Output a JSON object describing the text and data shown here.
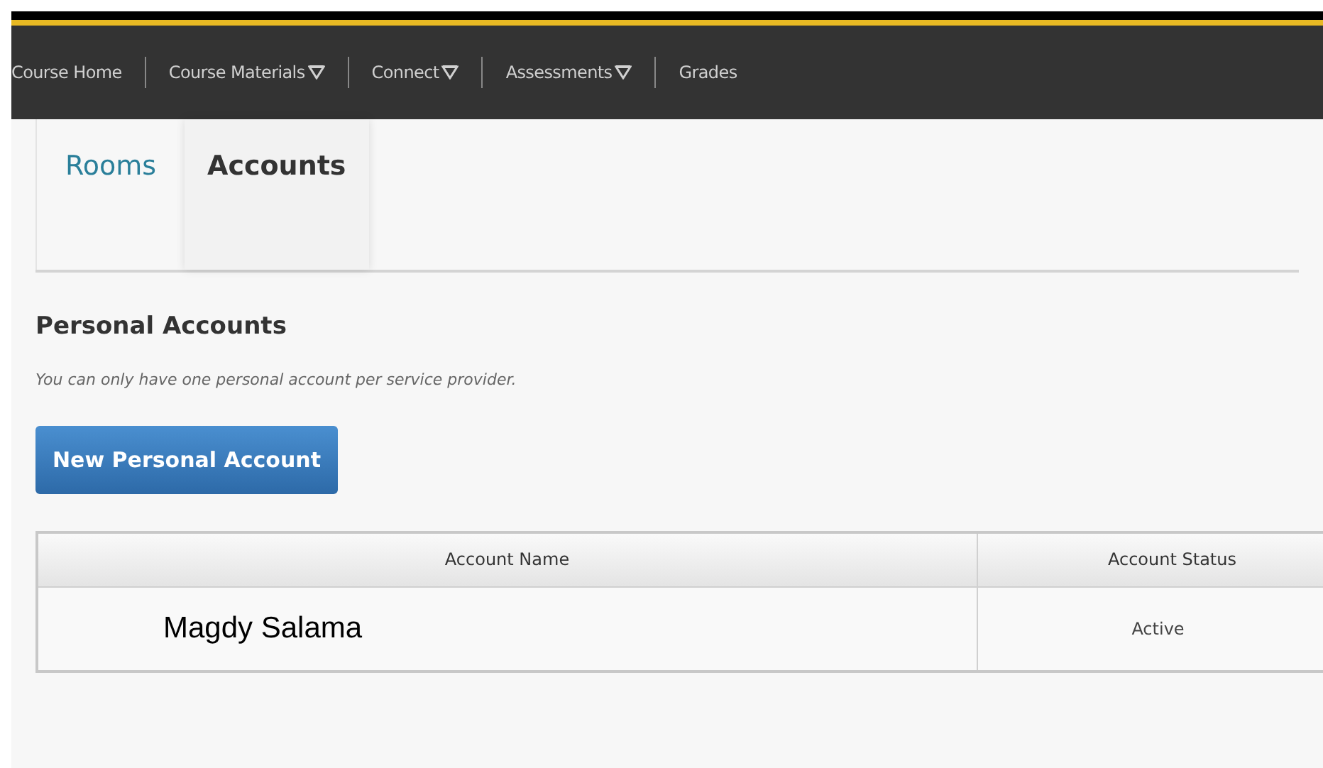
{
  "nav": [
    {
      "label": "Course Home",
      "dropdown": false
    },
    {
      "label": "Course Materials",
      "dropdown": true
    },
    {
      "label": "Connect",
      "dropdown": true
    },
    {
      "label": "Assessments",
      "dropdown": true
    },
    {
      "label": "Grades",
      "dropdown": false
    }
  ],
  "tabs": [
    {
      "label": "Rooms",
      "selected": false
    },
    {
      "label": "Accounts",
      "selected": true
    }
  ],
  "heading": "Personal Accounts",
  "note": "You can only have one personal account per service provider.",
  "new_button": "New Personal Account",
  "table": {
    "columns": [
      "Account Name",
      "Account Status"
    ],
    "rows": [
      [
        "Magdy Salama",
        "Active"
      ]
    ]
  }
}
